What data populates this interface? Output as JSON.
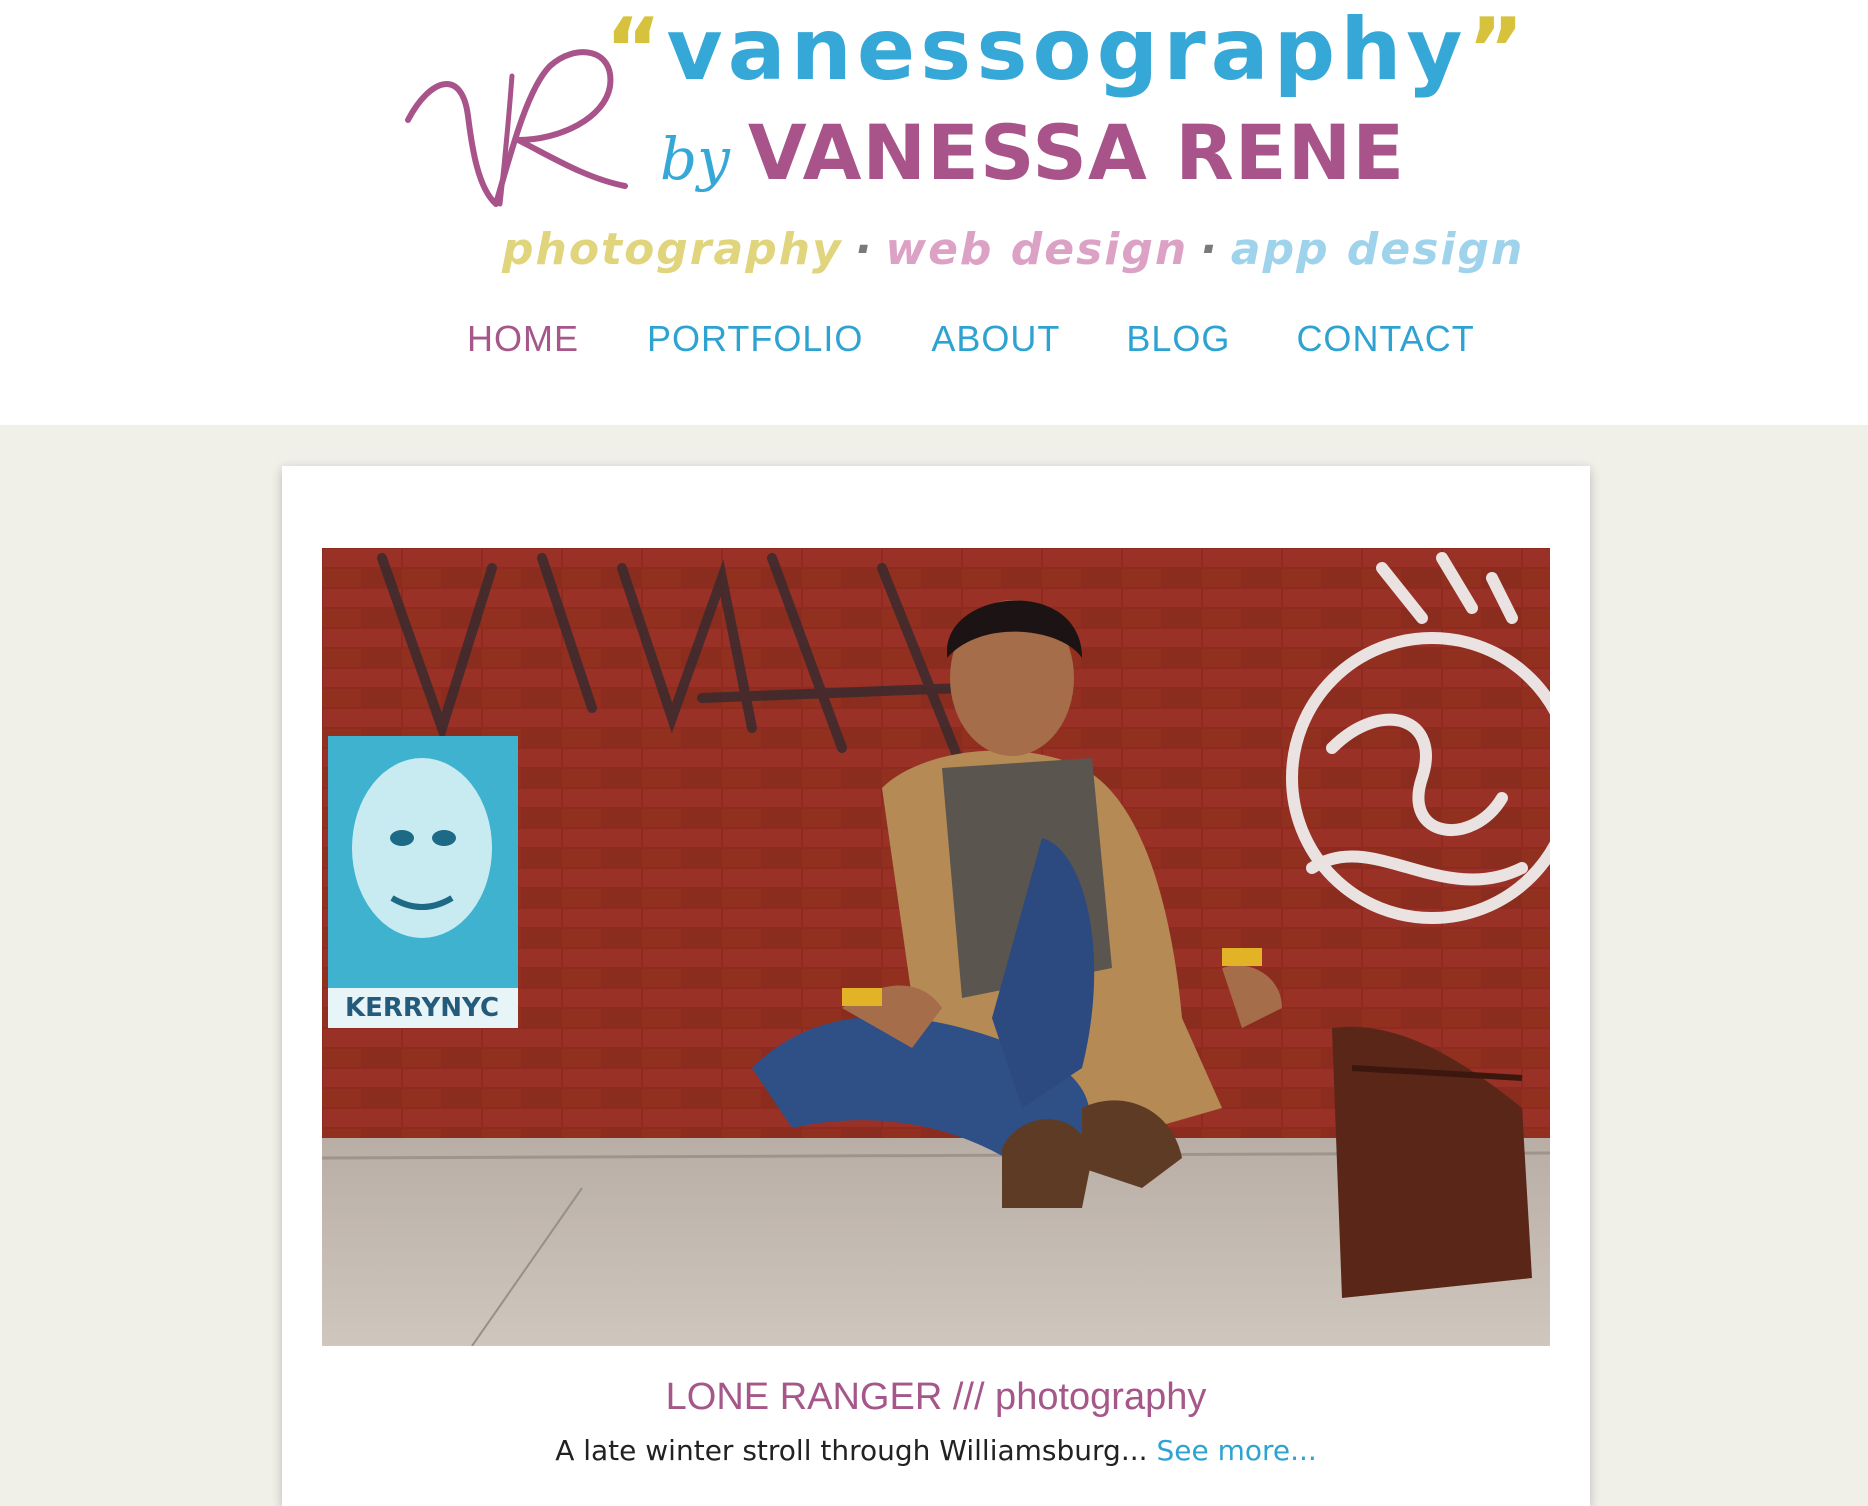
{
  "logo": {
    "title": "vanessography",
    "open_quote": "“",
    "close_quote": "”",
    "by": "by",
    "name": "VANESSA RENE",
    "tagline": {
      "photography": "photography",
      "web_design": "web design",
      "app_design": "app design",
      "separator": "·"
    },
    "colors": {
      "blue": "#35a8d8",
      "plum": "#a8538a",
      "gold": "#d6c23d"
    }
  },
  "nav": {
    "items": [
      {
        "label": "HOME",
        "active": true
      },
      {
        "label": "PORTFOLIO",
        "active": false
      },
      {
        "label": "ABOUT",
        "active": false
      },
      {
        "label": "BLOG",
        "active": false
      },
      {
        "label": "CONTACT",
        "active": false
      }
    ]
  },
  "post": {
    "title": "LONE RANGER /// photography",
    "excerpt": "A late winter stroll through Williamsburg...",
    "see_more": "See more...",
    "image": {
      "poster_text": "KERRYNYC"
    }
  },
  "colors": {
    "page_bg": "#f0efe8",
    "link": "#2ea3d2",
    "accent": "#a6578a"
  }
}
